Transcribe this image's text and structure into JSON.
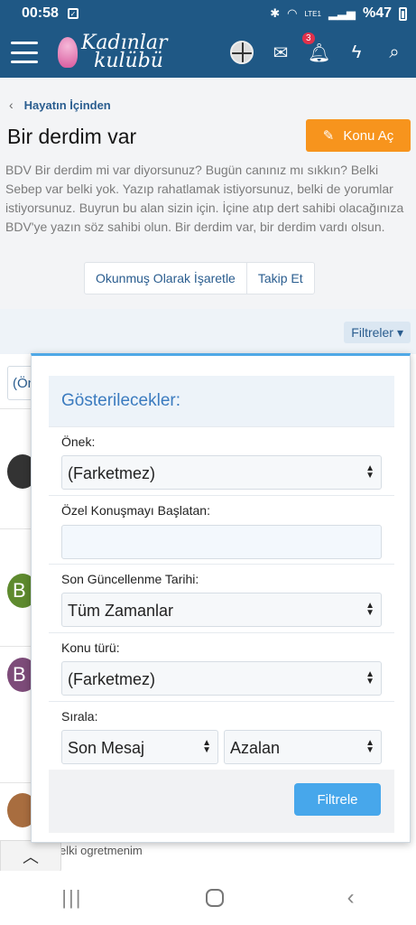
{
  "status": {
    "time": "00:58",
    "battery": "%47",
    "network": "LTE1"
  },
  "header": {
    "logo_line1": "Kadınlar",
    "logo_line2": "kulübü",
    "notification_count": "3"
  },
  "breadcrumb": "Hayatın İçinden",
  "page": {
    "title": "Bir derdim var",
    "new_topic_label": "Konu Aç",
    "description": "BDV Bir derdim mi var diyorsunuz? Bugün canınız mı sıkkın? Belki Sebep var belki yok. Yazıp rahatlamak istiyorsunuz, belki de yorumlar istiyorsunuz. Buyrun bu alan sizin için. İçine atıp dert sahibi olacağınıza BDV'ye yazın söz sahibi olun. Bir derdim var, bir derdim vardı olsun.",
    "mark_read_label": "Okunmuş Olarak İşaretle",
    "follow_label": "Takip Et"
  },
  "list": {
    "filters_label": "Filtreler",
    "prefix_chip": "(Ön",
    "avatar_letter_2": "B",
    "avatar_letter_3": "B",
    "snippet": "elki ogretmenim"
  },
  "filter_panel": {
    "title": "Gösterilecekler:",
    "prefix_label": "Önek:",
    "prefix_value": "(Farketmez)",
    "starter_label": "Özel Konuşmayı Başlatan:",
    "starter_value": "",
    "last_update_label": "Son Güncellenme Tarihi:",
    "last_update_value": "Tüm Zamanlar",
    "type_label": "Konu türü:",
    "type_value": "(Farketmez)",
    "sort_label": "Sırala:",
    "sort_field_value": "Son Mesaj",
    "sort_order_value": "Azalan",
    "submit_label": "Filtrele"
  }
}
